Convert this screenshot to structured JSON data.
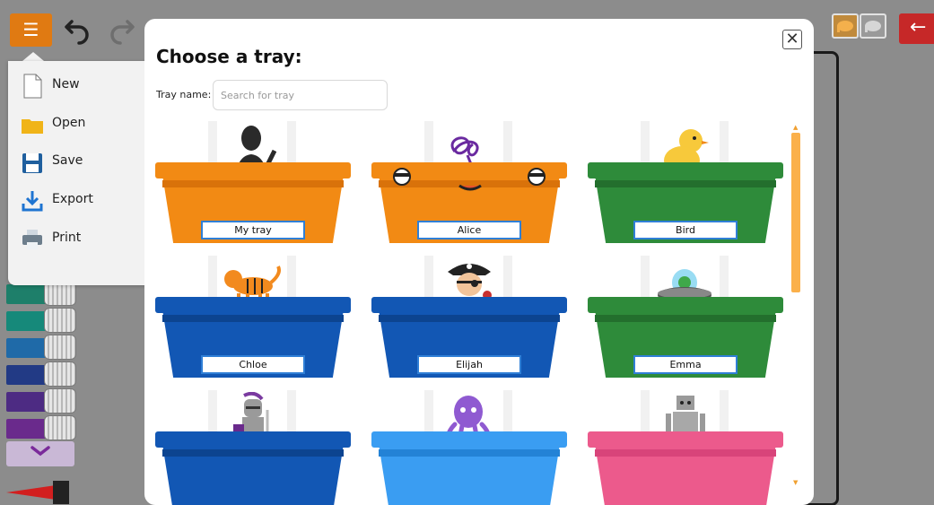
{
  "app": {
    "menu_icon": "hamburger-icon",
    "undo_icon": "undo-icon",
    "redo_icon": "redo-icon",
    "back_icon": "arrow-left-icon"
  },
  "file_menu": {
    "items": [
      {
        "label": "New",
        "icon": "new-file-icon"
      },
      {
        "label": "Open",
        "icon": "folder-icon"
      },
      {
        "label": "Save",
        "icon": "floppy-icon"
      },
      {
        "label": "Export",
        "icon": "download-icon"
      },
      {
        "label": "Print",
        "icon": "printer-icon"
      }
    ]
  },
  "modal": {
    "title": "Choose a tray:",
    "tray_name_label": "Tray name:",
    "search_placeholder": "Search for tray",
    "search_value": "",
    "trays": [
      {
        "name": "My tray",
        "color": "#f28a14",
        "art": "person-silhouette"
      },
      {
        "name": "Alice",
        "color": "#f28a14",
        "art": "scribble-face"
      },
      {
        "name": "Bird",
        "color": "#2e8b3a",
        "art": "chick"
      },
      {
        "name": "Chloe",
        "color": "#1257b4",
        "art": "tiger"
      },
      {
        "name": "Elijah",
        "color": "#1257b4",
        "art": "pirate"
      },
      {
        "name": "Emma",
        "color": "#2e8b3a",
        "art": "ufo"
      },
      {
        "name": "",
        "color": "#1257b4",
        "art": "knight"
      },
      {
        "name": "",
        "color": "#3a9df2",
        "art": "octopus"
      },
      {
        "name": "",
        "color": "#ec5a8c",
        "art": "robot"
      }
    ]
  },
  "colors": {
    "menu_button": "#e07a12",
    "back_button": "#c62828",
    "scrollbar": "#fbb04a",
    "nameplate_border": "#2f7fd6"
  }
}
